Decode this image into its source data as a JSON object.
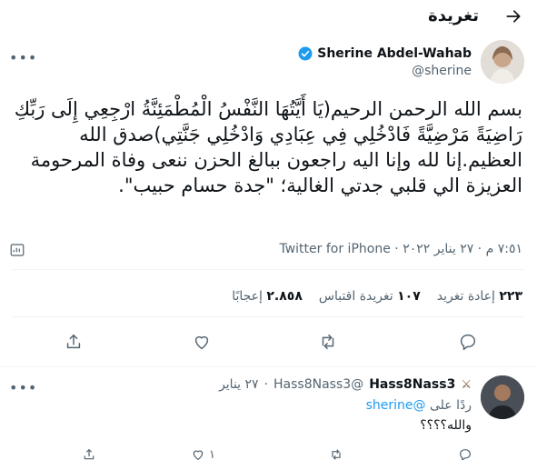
{
  "header": {
    "title": "تغريدة"
  },
  "author": {
    "name": "Sherine Abdel-Wahab",
    "handle": "@sherine"
  },
  "tweet": {
    "text": "بسم الله الرحمن الرحيم(يَا أَيَّتُهَا النَّفْسُ الْمُطْمَئِنَّةُ ارْجِعِي إِلَى رَبِّكِ رَاضِيَةً مَرْضِيَّةً فَادْخُلِي فِي عِبَادِي وَادْخُلِي جَنَّتِي)صدق الله العظيم.إنا لله وإنا اليه راجعون ببالغ الحزن ننعى وفاة المرحومة العزيزة الي قلبي جدتي الغالية؛ \"جدة حسام حبيب\".",
    "time": "٧:٥١ م",
    "date": "٢٧ يناير ٢٠٢٢",
    "source": "Twitter for iPhone"
  },
  "stats": [
    {
      "value": "٢٢٣",
      "label": "إعادة تغريد"
    },
    {
      "value": "١٠٧",
      "label": "تغريدة اقتباس"
    },
    {
      "value": "٢.٨٥٨",
      "label": "إعجابًا"
    }
  ],
  "reply": {
    "name": "Hass8Nass3",
    "handle": "@Hass8Nass3",
    "date": "٢٧ يناير",
    "reply_prefix": "ردًا على",
    "mention": "@sherine",
    "text": "والله؟؟؟؟",
    "like_count": "١"
  },
  "icons": {
    "back": "arrow-right-icon",
    "verified": "verified-badge-icon",
    "more": "more-dots-icon",
    "analytics": "analytics-icon",
    "reply": "reply-icon",
    "retweet": "retweet-icon",
    "like": "heart-icon",
    "share": "share-icon"
  },
  "colors": {
    "accent": "#1d9bf0",
    "muted": "#536471",
    "text": "#0f1419"
  }
}
